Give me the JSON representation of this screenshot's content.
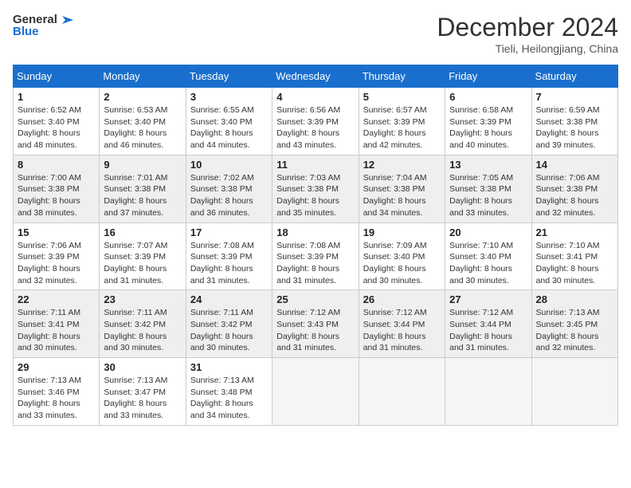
{
  "header": {
    "logo": {
      "general": "General",
      "blue": "Blue"
    },
    "title": "December 2024",
    "location": "Tieli, Heilongjiang, China"
  },
  "columns": [
    "Sunday",
    "Monday",
    "Tuesday",
    "Wednesday",
    "Thursday",
    "Friday",
    "Saturday"
  ],
  "weeks": [
    [
      {
        "day": 1,
        "sunrise": "6:52 AM",
        "sunset": "3:40 PM",
        "daylight": "8 hours and 48 minutes."
      },
      {
        "day": 2,
        "sunrise": "6:53 AM",
        "sunset": "3:40 PM",
        "daylight": "8 hours and 46 minutes."
      },
      {
        "day": 3,
        "sunrise": "6:55 AM",
        "sunset": "3:40 PM",
        "daylight": "8 hours and 44 minutes."
      },
      {
        "day": 4,
        "sunrise": "6:56 AM",
        "sunset": "3:39 PM",
        "daylight": "8 hours and 43 minutes."
      },
      {
        "day": 5,
        "sunrise": "6:57 AM",
        "sunset": "3:39 PM",
        "daylight": "8 hours and 42 minutes."
      },
      {
        "day": 6,
        "sunrise": "6:58 AM",
        "sunset": "3:39 PM",
        "daylight": "8 hours and 40 minutes."
      },
      {
        "day": 7,
        "sunrise": "6:59 AM",
        "sunset": "3:38 PM",
        "daylight": "8 hours and 39 minutes."
      }
    ],
    [
      {
        "day": 8,
        "sunrise": "7:00 AM",
        "sunset": "3:38 PM",
        "daylight": "8 hours and 38 minutes."
      },
      {
        "day": 9,
        "sunrise": "7:01 AM",
        "sunset": "3:38 PM",
        "daylight": "8 hours and 37 minutes."
      },
      {
        "day": 10,
        "sunrise": "7:02 AM",
        "sunset": "3:38 PM",
        "daylight": "8 hours and 36 minutes."
      },
      {
        "day": 11,
        "sunrise": "7:03 AM",
        "sunset": "3:38 PM",
        "daylight": "8 hours and 35 minutes."
      },
      {
        "day": 12,
        "sunrise": "7:04 AM",
        "sunset": "3:38 PM",
        "daylight": "8 hours and 34 minutes."
      },
      {
        "day": 13,
        "sunrise": "7:05 AM",
        "sunset": "3:38 PM",
        "daylight": "8 hours and 33 minutes."
      },
      {
        "day": 14,
        "sunrise": "7:06 AM",
        "sunset": "3:38 PM",
        "daylight": "8 hours and 32 minutes."
      }
    ],
    [
      {
        "day": 15,
        "sunrise": "7:06 AM",
        "sunset": "3:39 PM",
        "daylight": "8 hours and 32 minutes."
      },
      {
        "day": 16,
        "sunrise": "7:07 AM",
        "sunset": "3:39 PM",
        "daylight": "8 hours and 31 minutes."
      },
      {
        "day": 17,
        "sunrise": "7:08 AM",
        "sunset": "3:39 PM",
        "daylight": "8 hours and 31 minutes."
      },
      {
        "day": 18,
        "sunrise": "7:08 AM",
        "sunset": "3:39 PM",
        "daylight": "8 hours and 31 minutes."
      },
      {
        "day": 19,
        "sunrise": "7:09 AM",
        "sunset": "3:40 PM",
        "daylight": "8 hours and 30 minutes."
      },
      {
        "day": 20,
        "sunrise": "7:10 AM",
        "sunset": "3:40 PM",
        "daylight": "8 hours and 30 minutes."
      },
      {
        "day": 21,
        "sunrise": "7:10 AM",
        "sunset": "3:41 PM",
        "daylight": "8 hours and 30 minutes."
      }
    ],
    [
      {
        "day": 22,
        "sunrise": "7:11 AM",
        "sunset": "3:41 PM",
        "daylight": "8 hours and 30 minutes."
      },
      {
        "day": 23,
        "sunrise": "7:11 AM",
        "sunset": "3:42 PM",
        "daylight": "8 hours and 30 minutes."
      },
      {
        "day": 24,
        "sunrise": "7:11 AM",
        "sunset": "3:42 PM",
        "daylight": "8 hours and 30 minutes."
      },
      {
        "day": 25,
        "sunrise": "7:12 AM",
        "sunset": "3:43 PM",
        "daylight": "8 hours and 31 minutes."
      },
      {
        "day": 26,
        "sunrise": "7:12 AM",
        "sunset": "3:44 PM",
        "daylight": "8 hours and 31 minutes."
      },
      {
        "day": 27,
        "sunrise": "7:12 AM",
        "sunset": "3:44 PM",
        "daylight": "8 hours and 31 minutes."
      },
      {
        "day": 28,
        "sunrise": "7:13 AM",
        "sunset": "3:45 PM",
        "daylight": "8 hours and 32 minutes."
      }
    ],
    [
      {
        "day": 29,
        "sunrise": "7:13 AM",
        "sunset": "3:46 PM",
        "daylight": "8 hours and 33 minutes."
      },
      {
        "day": 30,
        "sunrise": "7:13 AM",
        "sunset": "3:47 PM",
        "daylight": "8 hours and 33 minutes."
      },
      {
        "day": 31,
        "sunrise": "7:13 AM",
        "sunset": "3:48 PM",
        "daylight": "8 hours and 34 minutes."
      },
      null,
      null,
      null,
      null
    ]
  ]
}
